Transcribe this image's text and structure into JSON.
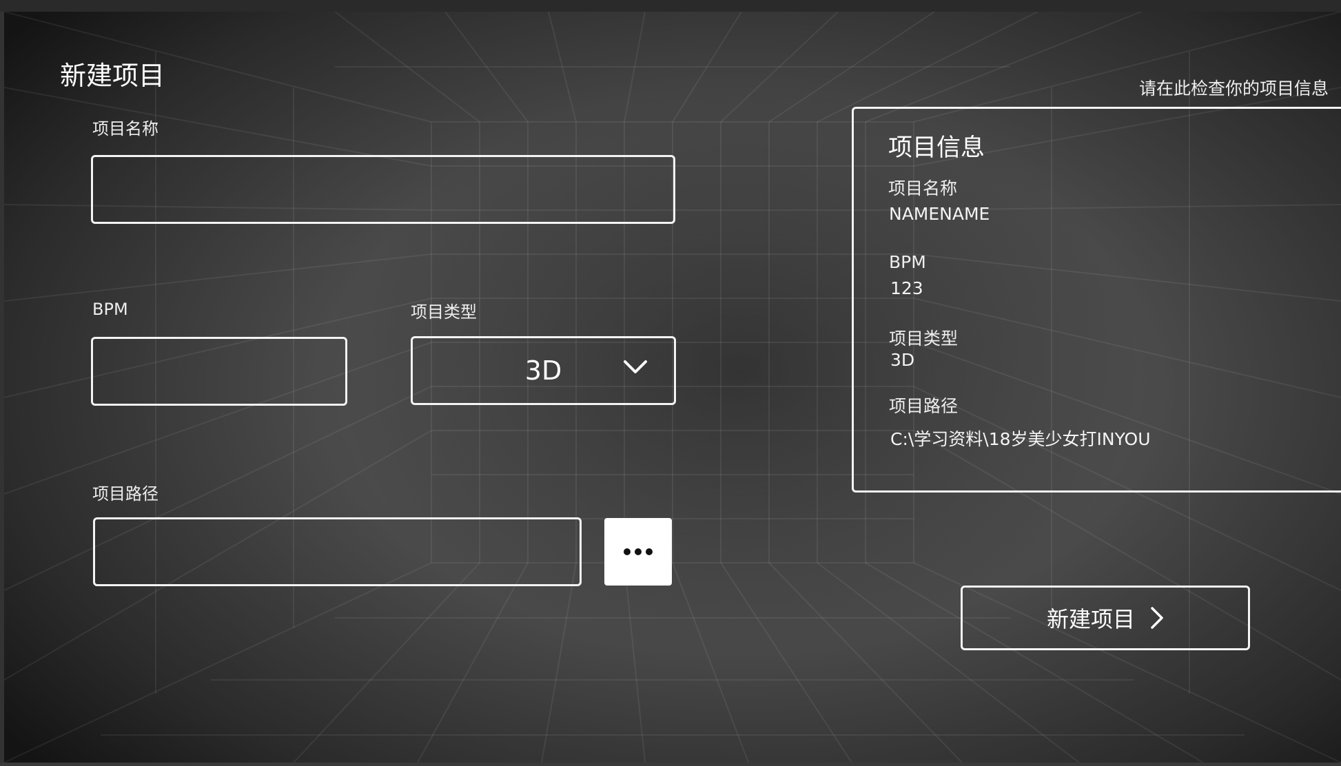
{
  "page": {
    "title": "新建项目"
  },
  "form": {
    "name_label": "项目名称",
    "name_value": "",
    "bpm_label": "BPM",
    "bpm_value": "",
    "type_label": "项目类型",
    "type_selected": "3D",
    "path_label": "项目路径",
    "path_value": "",
    "browse_label": "..."
  },
  "review": {
    "hint": "请在此检查你的项目信息",
    "panel_title": "项目信息",
    "name_label": "项目名称",
    "name_value": "NAMENAME",
    "bpm_label": "BPM",
    "bpm_value": "123",
    "type_label": "项目类型",
    "type_value": "3D",
    "path_label": "项目路径",
    "path_value": "C:\\学习资料\\18岁美少女打INYOU"
  },
  "actions": {
    "create_label": "新建项目"
  },
  "icons": {
    "dropdown": "chevron-down-icon",
    "create": "chevron-right-icon",
    "browse": "ellipsis-icon"
  },
  "colors": {
    "outline": "#f4f4f4",
    "text": "#ffffff",
    "background": "#4a4a4a"
  }
}
